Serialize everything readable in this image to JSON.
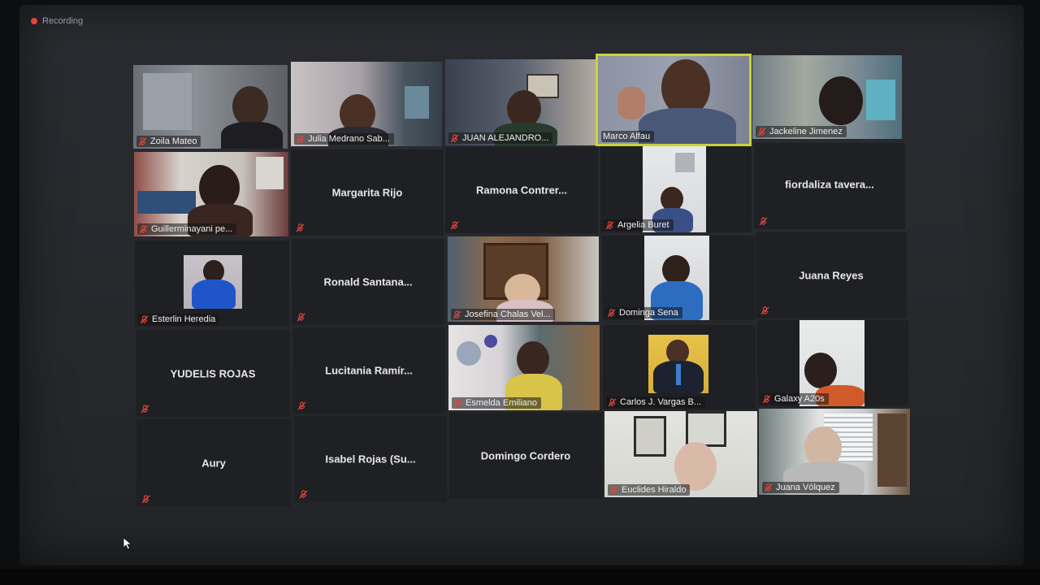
{
  "recording": {
    "label": "Recording"
  },
  "participants": {
    "p1": "Zoila Mateo",
    "p2": "Julia Medrano Sab...",
    "p3": "JUAN ALEJANDRO...",
    "p4": "Marco Alfau",
    "p5": "Jackeline Jimenez",
    "p6": "Guillerminayani pe...",
    "p7": "Margarita Rijo",
    "p8": "Ramona  Contrer...",
    "p9": "Argelia Buret",
    "p10": "fiordaliza  tavera...",
    "p11": "Esterlin Heredia",
    "p12": "Ronald  Santana...",
    "p13": "Josefina Chalas Vel...",
    "p14": "Dominga Sena",
    "p15": "Juana Reyes",
    "p16": "YUDELIS ROJAS",
    "p17": "Lucitania  Ramír...",
    "p18": "Esmelda Emiliano",
    "p19": "Carlos J. Vargas B...",
    "p20": "Galaxy A20s",
    "p21": "Aury",
    "p22": "Isabel Rojas  (Su...",
    "p23": "Domingo Cordero",
    "p24": "Euclides Hiraldo",
    "p25": "Juana Vólquez"
  },
  "colors": {
    "active_speaker": "#c9d23a",
    "muted_icon": "#e0453c",
    "recording_dot": "#e0453c"
  },
  "icons": {
    "muted": "mic-muted-icon",
    "cursor": "mouse-cursor-icon"
  }
}
